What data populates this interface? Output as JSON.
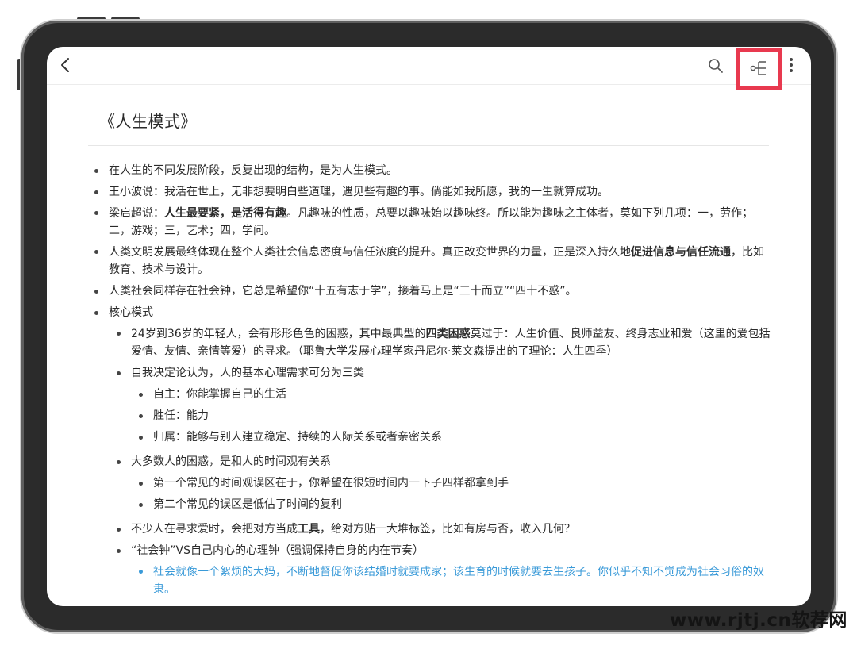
{
  "icons": {
    "back": "chevron-left-icon",
    "search": "search-icon",
    "mindmap": "mindmap-icon",
    "more": "more-vertical-icon"
  },
  "colors": {
    "highlight_box": "#e8394f",
    "link_text": "#3a9ad8"
  },
  "document": {
    "title": "《人生模式》"
  },
  "outline": {
    "i1": "在人生的不同发展阶段，反复出现的结构，是为人生模式。",
    "i2": "王小波说：我活在世上，无非想要明白些道理，遇见些有趣的事。倘能如我所愿，我的一生就算成功。",
    "i3": {
      "a": "梁启超说：",
      "b": "人生最要紧，是活得有趣",
      "c": "。凡趣味的性质，总要以趣味始以趣味终。所以能为趣味之主体者，莫如下列几项：一，劳作；二，游戏；三，艺术；四，学问。"
    },
    "i4": {
      "a": "人类文明发展最终体现在整个人类社会信息密度与信任浓度的提升。真正改变世界的力量，正是深入持久地",
      "b": "促进信息与信任流通",
      "c": "，比如教育、技术与设计。"
    },
    "i5": "人类社会同样存在社会钟，它总是希望你“十五有志于学”，接着马上是“三十而立”“四十不惑”。",
    "i6": "核心模式",
    "i6_1": {
      "a": "24岁到36岁的年轻人，会有形形色色的困惑，其中最典型的",
      "b": "四类困惑",
      "c": "莫过于：人生价值、良师益友、终身志业和爱（这里的爱包括爱情、友情、亲情等爱）的寻求。（耶鲁大学发展心理学家丹尼尔·莱文森提出的了理论：人生四季）"
    },
    "i6_2": "自我决定论认为，人的基本心理需求可分为三类",
    "i6_2_1": "自主：你能掌握自己的生活",
    "i6_2_2": "胜任：能力",
    "i6_2_3": "归属：能够与别人建立稳定、持续的人际关系或者亲密关系",
    "i6_3": "大多数人的困惑，是和人的时间观有关系",
    "i6_3_1": "第一个常见的时间观误区在于，你希望在很短时间内一下子四样都拿到手",
    "i6_3_2": "第二个常见的误区是低估了时间的复利",
    "i6_4": {
      "a": "不少人在寻求爱时，会把对方当成",
      "b": "工具",
      "c": "，给对方贴一大堆标签，比如有房与否，收入几何？"
    },
    "i6_5": "“社会钟”VS自己内心的心理钟（强调保持自身的内在节奏）",
    "i6_5_1": "社会就像一个絮烦的大妈，不断地督促你该结婚时就要成家；该生育的时候就要去生孩子。你似乎不知不觉成为社会习俗的奴隶。"
  },
  "watermark": "www.rjtj.cn软荐网"
}
